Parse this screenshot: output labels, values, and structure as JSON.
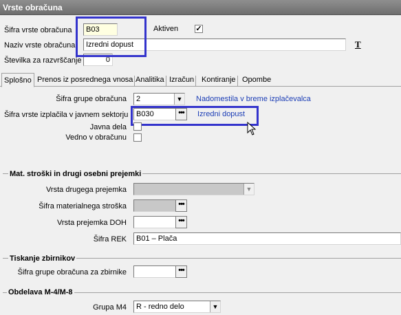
{
  "window": {
    "title": "Vrste obračuna"
  },
  "header": {
    "code_label": "Šifra vrste obračuna",
    "code_value": "B03",
    "active_label": "Aktiven",
    "active_checked": "✓",
    "name_label": "Naziv vrste obračuna",
    "name_value": "Izredni dopust",
    "sort_label": "Številka  za razvrščanje",
    "sort_value": "0",
    "font_icon": "T"
  },
  "tabs": [
    {
      "label": "Splošno"
    },
    {
      "label": "Prenos iz posrednega vnosa"
    },
    {
      "label": "Analitika"
    },
    {
      "label": "Izračun"
    },
    {
      "label": "Kontiranje"
    },
    {
      "label": "Opombe"
    }
  ],
  "general": {
    "group_label": "Šifra grupe obračuna",
    "group_value": "2",
    "group_link": "Nadomestila v breme izplačevalca",
    "public_code_label": "Šifra vrste izplačila v javnem sektorju",
    "public_code_value": "B030",
    "public_code_link": "Izredni dopust",
    "javna_label": "Javna dela",
    "always_label": "Vedno v obračunu"
  },
  "costs": {
    "title": "Mat. stroški in drugi osebni prejemki",
    "other_type_label": "Vrsta drugega prejemka",
    "material_label": "Šifra materialnega stroška",
    "doh_label": "Vrsta prejemka DOH",
    "rek_label": "Šifra REK",
    "rek_value": "B01 – Plača"
  },
  "print": {
    "title": "Tiskanje zbirnikov",
    "group_label": "Šifra grupe obračuna za zbirnike"
  },
  "m4": {
    "title": "Obdelava M-4/M-8",
    "group_label": "Grupa M4",
    "group_value": "R - redno delo"
  },
  "icons": {
    "dots": "•••",
    "dropdown": "▼"
  },
  "colors": {
    "link": "#1a3cb5",
    "highlight": "#3333cc",
    "code_bg": "#ffffe1"
  }
}
